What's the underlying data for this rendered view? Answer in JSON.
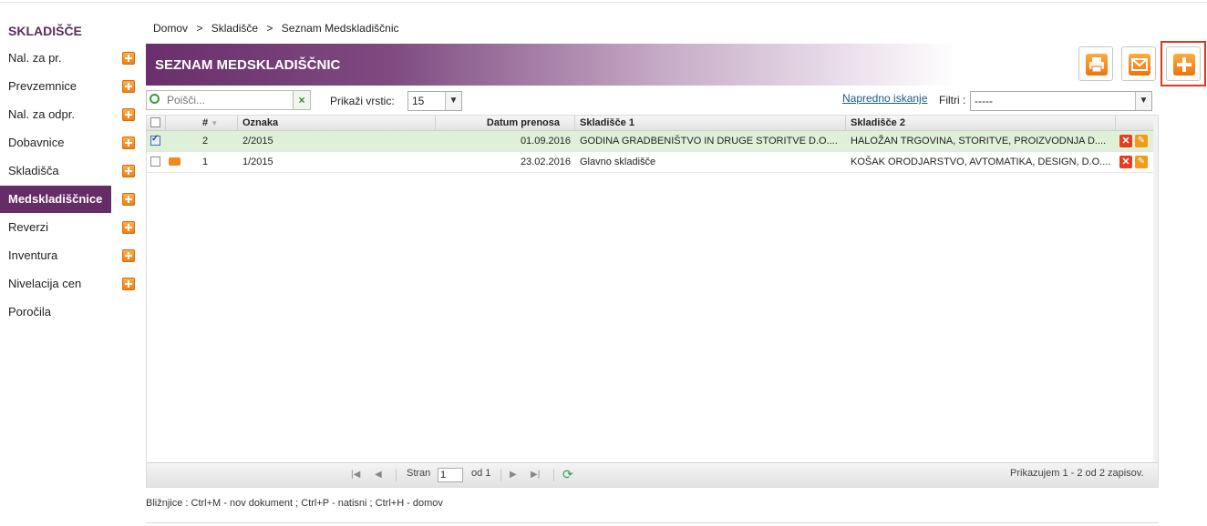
{
  "sidebar": {
    "title": "SKLADIŠČE",
    "items": [
      {
        "label": "Nal. za pr.",
        "has_add": true
      },
      {
        "label": "Prevzemnice",
        "has_add": true
      },
      {
        "label": "Nal. za odpr.",
        "has_add": true
      },
      {
        "label": "Dobavnice",
        "has_add": true
      },
      {
        "label": "Skladišča",
        "has_add": true
      },
      {
        "label": "Medskladiščnice",
        "has_add": true,
        "active": true
      },
      {
        "label": "Reverzi",
        "has_add": true
      },
      {
        "label": "Inventura",
        "has_add": true
      },
      {
        "label": "Nivelacija cen",
        "has_add": true
      },
      {
        "label": "Poročila",
        "has_add": false
      }
    ]
  },
  "breadcrumb": [
    "Domov",
    ">",
    "Skladišče",
    ">",
    "Seznam Medskladiščnic"
  ],
  "header": {
    "title": "SEZNAM MEDSKLADIŠČNIC",
    "icons": {
      "print": "printer-icon",
      "email": "envelope-icon",
      "add": "plus-icon"
    }
  },
  "toolbar": {
    "search_placeholder": "Poišči...",
    "rows_label": "Prikaži vrstic:",
    "rows_value": "15",
    "advanced_search": "Napredno iskanje",
    "filter_label": "Filtri :",
    "filter_value": "-----"
  },
  "grid": {
    "columns": [
      "",
      "#",
      "Oznaka",
      "Datum prenosa",
      "Skladišče 1",
      "Skladišče 2"
    ],
    "rows": [
      {
        "checked": true,
        "print": false,
        "num": "2",
        "oznaka": "2/2015",
        "datum": "01.09.2016",
        "sklad1": "GODINA GRADBENIŠTVO IN DRUGE STORITVE D.O....",
        "sklad2": "HALOŽAN TRGOVINA, STORITVE, PROIZVODNJA D...."
      },
      {
        "checked": false,
        "print": true,
        "num": "1",
        "oznaka": "1/2015",
        "datum": "23.02.2016",
        "sklad1": "Glavno skladišče",
        "sklad2": "KOŠAK ORODJARSTVO, AVTOMATIKA, DESIGN, D.O...."
      }
    ],
    "pager": {
      "page_label": "Stran",
      "page_value": "1",
      "of_label": "od 1",
      "summary": "Prikazujem 1 - 2 od 2 zapisov."
    }
  },
  "shortcuts": "Bližnjice : Ctrl+M - nov dokument ;  Ctrl+P - natisni ;  Ctrl+H - domov"
}
